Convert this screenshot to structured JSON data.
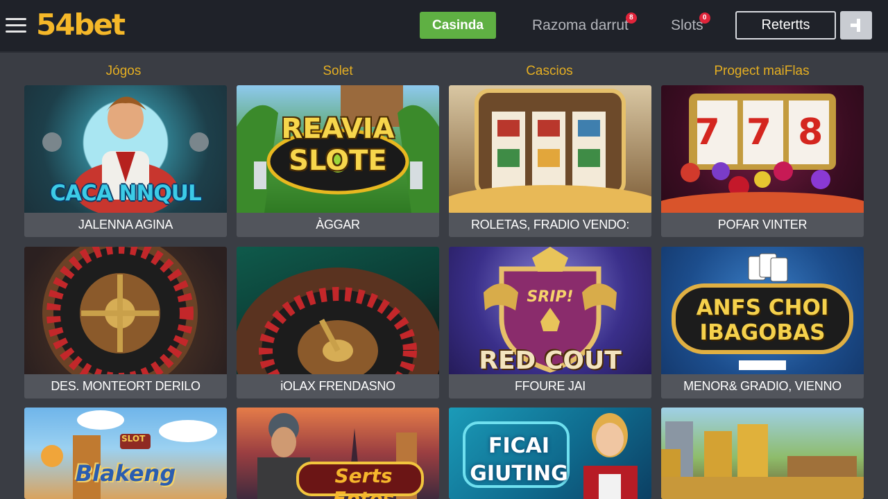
{
  "header": {
    "logo": "54bet",
    "nav": [
      {
        "label": "Casinda",
        "active": true
      },
      {
        "label": "Razoma darrut",
        "badge": "8"
      },
      {
        "label": "Slots",
        "badge": "0"
      }
    ],
    "login_label": "Retertts",
    "accent_color": "#f5b829",
    "active_color": "#5fb043"
  },
  "categories": [
    "Jógos",
    "Solet",
    "Cascios",
    "Progect maiFlas"
  ],
  "games": [
    {
      "title": "CACA NNQUL",
      "label": "JALENNA AGINA"
    },
    {
      "title": "REAVIA SLOTE",
      "label": "ÀGGAR"
    },
    {
      "title": "",
      "label": "ROLETAS, FRADIO VENDO:"
    },
    {
      "title": "7 7 8",
      "label": "POFAR VINTER"
    },
    {
      "title": "",
      "label": "DES. MONTEORT DERILO"
    },
    {
      "title": "",
      "label": "iOLAX FRENDASNO"
    },
    {
      "title": "RED COUT",
      "badge": "SRIP!",
      "label": "FFOURE JAI"
    },
    {
      "title": "ANFS CHOI IBAGOBAS",
      "label": "MENOR& GRADIO, VIENNO"
    },
    {
      "title": "Blakeng",
      "badge": "SLOT",
      "label": ""
    },
    {
      "title": "Serts Eptos",
      "label": ""
    },
    {
      "title": "FICAI GIUTING",
      "label": ""
    },
    {
      "title": "",
      "label": ""
    }
  ]
}
